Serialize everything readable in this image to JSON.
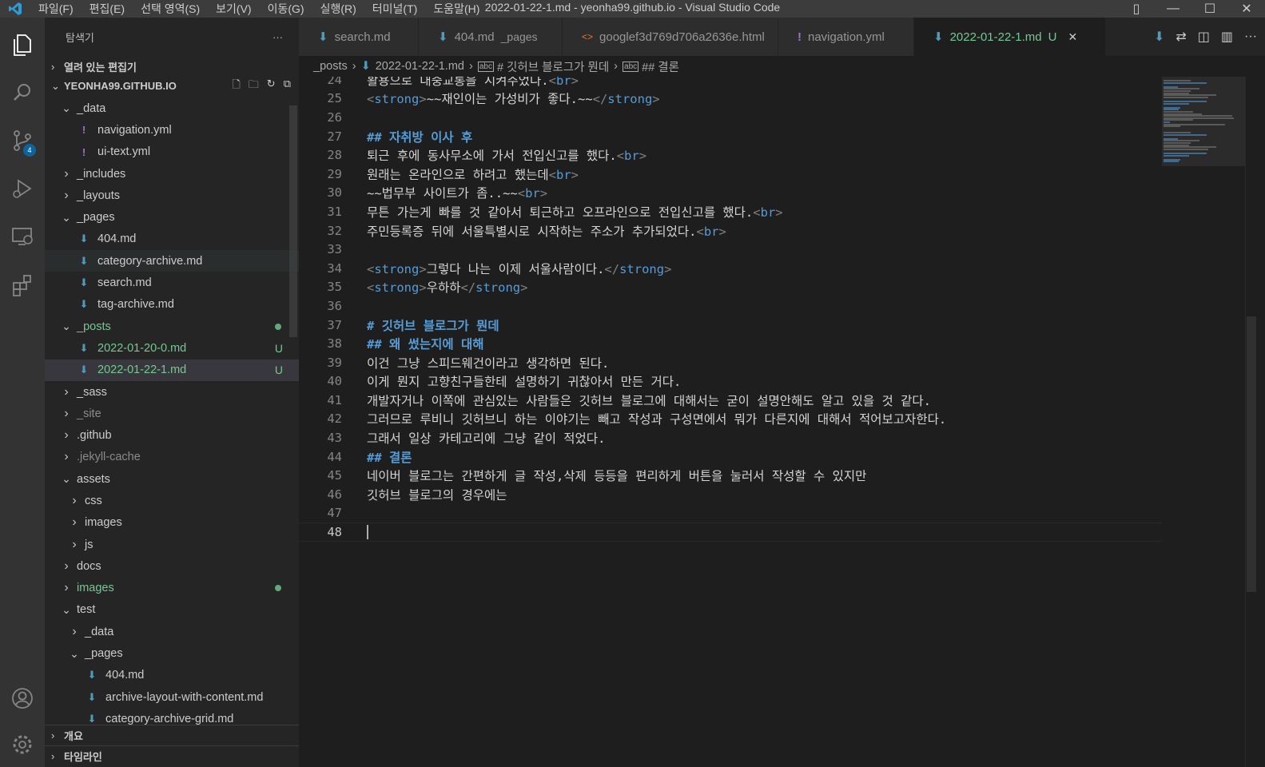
{
  "titlebar": {
    "title": "2022-01-22-1.md - yeonha99.github.io - Visual Studio Code",
    "menu": [
      "파일(F)",
      "편집(E)",
      "선택 영역(S)",
      "보기(V)",
      "이동(G)",
      "실행(R)",
      "터미널(T)",
      "도움말(H)"
    ]
  },
  "activity": {
    "scm_badge": "4"
  },
  "sidebar": {
    "header": "탐색기",
    "more": "···",
    "open_editors": "열려 있는 편집기",
    "project": "YEONHA99.GITHUB.IO",
    "tree": [
      {
        "label": "_data",
        "type": "folder-open",
        "depth": 1
      },
      {
        "label": "navigation.yml",
        "type": "yml",
        "depth": 2
      },
      {
        "label": "ui-text.yml",
        "type": "yml",
        "depth": 2
      },
      {
        "label": "_includes",
        "type": "folder",
        "depth": 1
      },
      {
        "label": "_layouts",
        "type": "folder",
        "depth": 1
      },
      {
        "label": "_pages",
        "type": "folder-open",
        "depth": 1
      },
      {
        "label": "404.md",
        "type": "md",
        "depth": 2
      },
      {
        "label": "category-archive.md",
        "type": "md",
        "depth": 2,
        "hover": true
      },
      {
        "label": "search.md",
        "type": "md",
        "depth": 2
      },
      {
        "label": "tag-archive.md",
        "type": "md",
        "depth": 2
      },
      {
        "label": "_posts",
        "type": "folder-open",
        "depth": 1,
        "status": "dot",
        "color": "green"
      },
      {
        "label": "2022-01-20-0.md",
        "type": "md",
        "depth": 2,
        "status": "U",
        "color": "green"
      },
      {
        "label": "2022-01-22-1.md",
        "type": "md",
        "depth": 2,
        "status": "U",
        "color": "green",
        "selected": true
      },
      {
        "label": "_sass",
        "type": "folder",
        "depth": 1
      },
      {
        "label": "_site",
        "type": "folder",
        "depth": 1,
        "color": "gray"
      },
      {
        "label": ".github",
        "type": "folder",
        "depth": 1
      },
      {
        "label": ".jekyll-cache",
        "type": "folder",
        "depth": 1,
        "color": "gray"
      },
      {
        "label": "assets",
        "type": "folder-open",
        "depth": 1
      },
      {
        "label": "css",
        "type": "folder",
        "depth": 2
      },
      {
        "label": "images",
        "type": "folder",
        "depth": 2
      },
      {
        "label": "js",
        "type": "folder",
        "depth": 2
      },
      {
        "label": "docs",
        "type": "folder",
        "depth": 1
      },
      {
        "label": "images",
        "type": "folder",
        "depth": 1,
        "status": "dot",
        "color": "green"
      },
      {
        "label": "test",
        "type": "folder-open",
        "depth": 1
      },
      {
        "label": "_data",
        "type": "folder",
        "depth": 2
      },
      {
        "label": "_pages",
        "type": "folder-open",
        "depth": 2
      },
      {
        "label": "404.md",
        "type": "md",
        "depth": 3
      },
      {
        "label": "archive-layout-with-content.md",
        "type": "md",
        "depth": 3
      },
      {
        "label": "category-archive-grid.md",
        "type": "md",
        "depth": 3
      },
      {
        "label": "",
        "type": "md",
        "depth": 3
      }
    ],
    "outline": "개요",
    "timeline": "타임라인"
  },
  "tabs": [
    {
      "label": "search.md",
      "icon": "md",
      "path": ""
    },
    {
      "label": "404.md",
      "icon": "md",
      "path": "_pages"
    },
    {
      "label": "googlef3d769d706a2636e.html",
      "icon": "html",
      "path": ""
    },
    {
      "label": "navigation.yml",
      "icon": "yml",
      "path": ""
    },
    {
      "label": "2022-01-22-1.md",
      "icon": "md",
      "path": "",
      "active": true,
      "status": "U",
      "close": "✕"
    }
  ],
  "breadcrumb": {
    "folder": "_posts",
    "file": "2022-01-22-1.md",
    "section1": "# 깃허브 블로그가 뭔데",
    "section2": "## 결론"
  },
  "editor": {
    "current_line": 48,
    "lines": [
      {
        "n": "24",
        "parts": [
          [
            "t",
            "활용으로 대중교통을 시켜주었다."
          ],
          [
            "b",
            "<"
          ],
          [
            "g",
            "br"
          ],
          [
            "b",
            ">"
          ]
        ]
      },
      {
        "n": "25",
        "parts": [
          [
            "b",
            "<"
          ],
          [
            "g",
            "strong"
          ],
          [
            "b",
            ">"
          ],
          [
            "t",
            "~~재인이는 가성비가 좋다.~~"
          ],
          [
            "b",
            "</"
          ],
          [
            "g",
            "strong"
          ],
          [
            "b",
            ">"
          ]
        ]
      },
      {
        "n": "26",
        "parts": []
      },
      {
        "n": "27",
        "parts": [
          [
            "h",
            "## 자취방 이사 후"
          ]
        ]
      },
      {
        "n": "28",
        "parts": [
          [
            "t",
            "퇴근 후에 동사무소에 가서 전입신고를 했다."
          ],
          [
            "b",
            "<"
          ],
          [
            "g",
            "br"
          ],
          [
            "b",
            ">"
          ]
        ]
      },
      {
        "n": "29",
        "parts": [
          [
            "t",
            "원래는 온라인으로 하려고 했는데"
          ],
          [
            "b",
            "<"
          ],
          [
            "g",
            "br"
          ],
          [
            "b",
            ">"
          ]
        ]
      },
      {
        "n": "30",
        "parts": [
          [
            "t",
            "~~법무부 사이트가 좀..~~"
          ],
          [
            "b",
            "<"
          ],
          [
            "g",
            "br"
          ],
          [
            "b",
            ">"
          ]
        ]
      },
      {
        "n": "31",
        "parts": [
          [
            "t",
            "무튼 가는게 빠를 것 같아서 퇴근하고 오프라인으로 전입신고를 했다."
          ],
          [
            "b",
            "<"
          ],
          [
            "g",
            "br"
          ],
          [
            "b",
            ">"
          ]
        ]
      },
      {
        "n": "32",
        "parts": [
          [
            "t",
            "주민등록증 뒤에 서울특별시로 시작하는 주소가 추가되었다."
          ],
          [
            "b",
            "<"
          ],
          [
            "g",
            "br"
          ],
          [
            "b",
            ">"
          ]
        ]
      },
      {
        "n": "33",
        "parts": []
      },
      {
        "n": "34",
        "parts": [
          [
            "b",
            "<"
          ],
          [
            "g",
            "strong"
          ],
          [
            "b",
            ">"
          ],
          [
            "t",
            "그렇다 나는 이제 서울사람이다."
          ],
          [
            "b",
            "</"
          ],
          [
            "g",
            "strong"
          ],
          [
            "b",
            ">"
          ]
        ]
      },
      {
        "n": "35",
        "parts": [
          [
            "b",
            "<"
          ],
          [
            "g",
            "strong"
          ],
          [
            "b",
            ">"
          ],
          [
            "t",
            "우하하"
          ],
          [
            "b",
            "</"
          ],
          [
            "g",
            "strong"
          ],
          [
            "b",
            ">"
          ]
        ]
      },
      {
        "n": "36",
        "parts": []
      },
      {
        "n": "37",
        "parts": [
          [
            "h",
            "# 깃허브 블로그가 뭔데"
          ]
        ]
      },
      {
        "n": "38",
        "parts": [
          [
            "h",
            "## 왜 썼는지에 대해"
          ]
        ]
      },
      {
        "n": "39",
        "parts": [
          [
            "t",
            "이건 그냥 스피드웨건이라고 생각하면 된다."
          ]
        ]
      },
      {
        "n": "40",
        "parts": [
          [
            "t",
            "이게 뭔지 고향친구들한테 설명하기 귀찮아서 만든 거다."
          ]
        ]
      },
      {
        "n": "41",
        "parts": [
          [
            "t",
            "개발자거나 이쪽에 관심있는 사람들은 깃허브 블로그에 대해서는 굳이 설명안해도 알고 있을 것 같다."
          ]
        ]
      },
      {
        "n": "42",
        "parts": [
          [
            "t",
            "그러므로 루비니 깃허브니 하는 이야기는 빼고 작성과 구성면에서 뭐가 다른지에 대해서 적어보고자한다."
          ]
        ]
      },
      {
        "n": "43",
        "parts": [
          [
            "t",
            "그래서 일상 카테고리에 그냥 같이 적었다."
          ]
        ]
      },
      {
        "n": "44",
        "parts": [
          [
            "h",
            "## 결론"
          ]
        ]
      },
      {
        "n": "45",
        "parts": [
          [
            "t",
            "네이버 블로그는 간편하게 글 작성,삭제 등등을 편리하게 버튼을 눌러서 작성할 수 있지만"
          ]
        ]
      },
      {
        "n": "46",
        "parts": [
          [
            "t",
            "깃허브 블로그의 경우에는"
          ]
        ]
      },
      {
        "n": "47",
        "parts": []
      },
      {
        "n": "48",
        "parts": []
      }
    ]
  },
  "colors": {
    "accent": "#007acc",
    "git_untracked": "#73c991",
    "markup_tag": "#569cd6",
    "md_icon": "#519aba",
    "yml_icon": "#a074c4",
    "html_icon": "#e37933"
  }
}
